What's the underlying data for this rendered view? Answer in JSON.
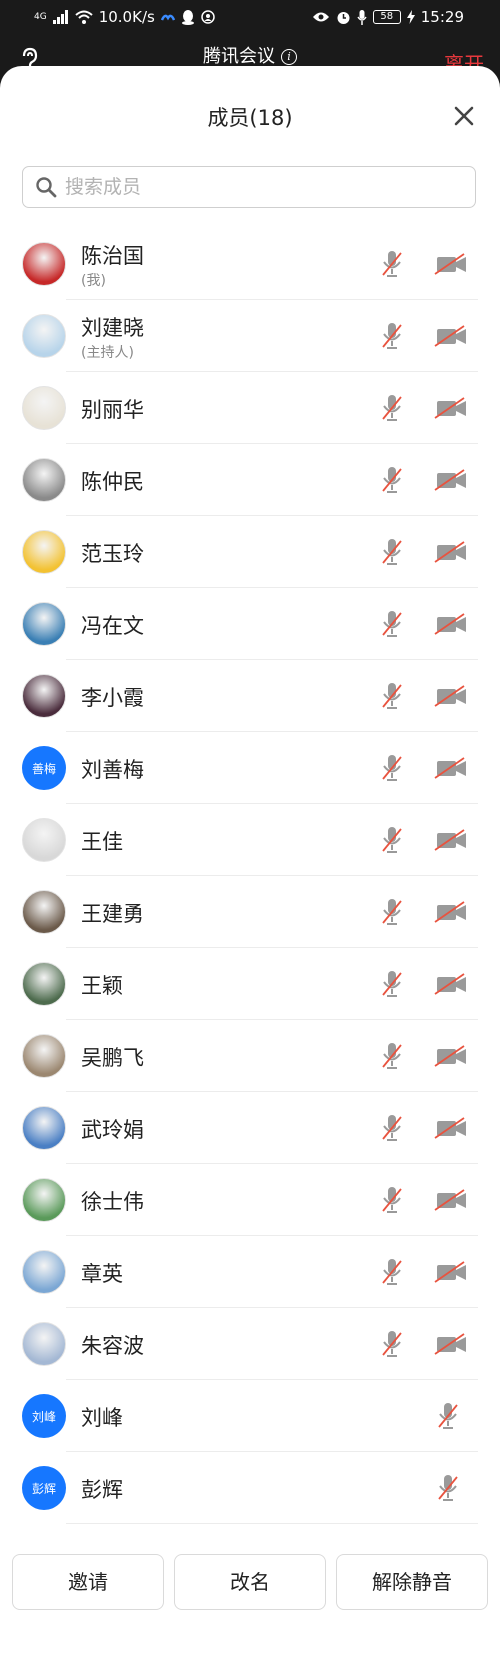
{
  "status_bar": {
    "network": "4G",
    "speed": "10.0K/s",
    "battery": "58",
    "time": "15:29"
  },
  "meeting": {
    "title": "腾讯会议",
    "leave_label": "离开"
  },
  "panel": {
    "title": "成员(18)",
    "search_placeholder": "搜索成员"
  },
  "members": [
    {
      "name": "陈治国",
      "role": "(我)",
      "avatar": "photo",
      "video": true
    },
    {
      "name": "刘建晓",
      "role": "(主持人)",
      "avatar": "photo",
      "video": true
    },
    {
      "name": "别丽华",
      "role": "",
      "avatar": "photo",
      "video": true
    },
    {
      "name": "陈仲民",
      "role": "",
      "avatar": "photo",
      "video": true
    },
    {
      "name": "范玉玲",
      "role": "",
      "avatar": "photo",
      "video": true
    },
    {
      "name": "冯在文",
      "role": "",
      "avatar": "photo",
      "video": true
    },
    {
      "name": "李小霞",
      "role": "",
      "avatar": "photo",
      "video": true
    },
    {
      "name": "刘善梅",
      "role": "",
      "avatar": "善梅",
      "video": true
    },
    {
      "name": "王佳",
      "role": "",
      "avatar": "photo",
      "video": true
    },
    {
      "name": "王建勇",
      "role": "",
      "avatar": "photo",
      "video": true
    },
    {
      "name": "王颖",
      "role": "",
      "avatar": "photo",
      "video": true
    },
    {
      "name": "吴鹏飞",
      "role": "",
      "avatar": "photo",
      "video": true
    },
    {
      "name": "武玲娟",
      "role": "",
      "avatar": "photo",
      "video": true
    },
    {
      "name": "徐士伟",
      "role": "",
      "avatar": "photo",
      "video": true
    },
    {
      "name": "章英",
      "role": "",
      "avatar": "photo",
      "video": true
    },
    {
      "name": "朱容波",
      "role": "",
      "avatar": "photo",
      "video": true
    },
    {
      "name": "刘峰",
      "role": "",
      "avatar": "刘峰",
      "video": false
    },
    {
      "name": "彭辉",
      "role": "",
      "avatar": "彭辉",
      "video": false
    }
  ],
  "actions": {
    "invite": "邀请",
    "rename": "改名",
    "unmute": "解除静音"
  },
  "colors": {
    "accent_blue": "#1677ff",
    "leave_red": "#e8383d",
    "muted_strike": "#e8533f",
    "icon_gray": "#9a9a9a"
  }
}
